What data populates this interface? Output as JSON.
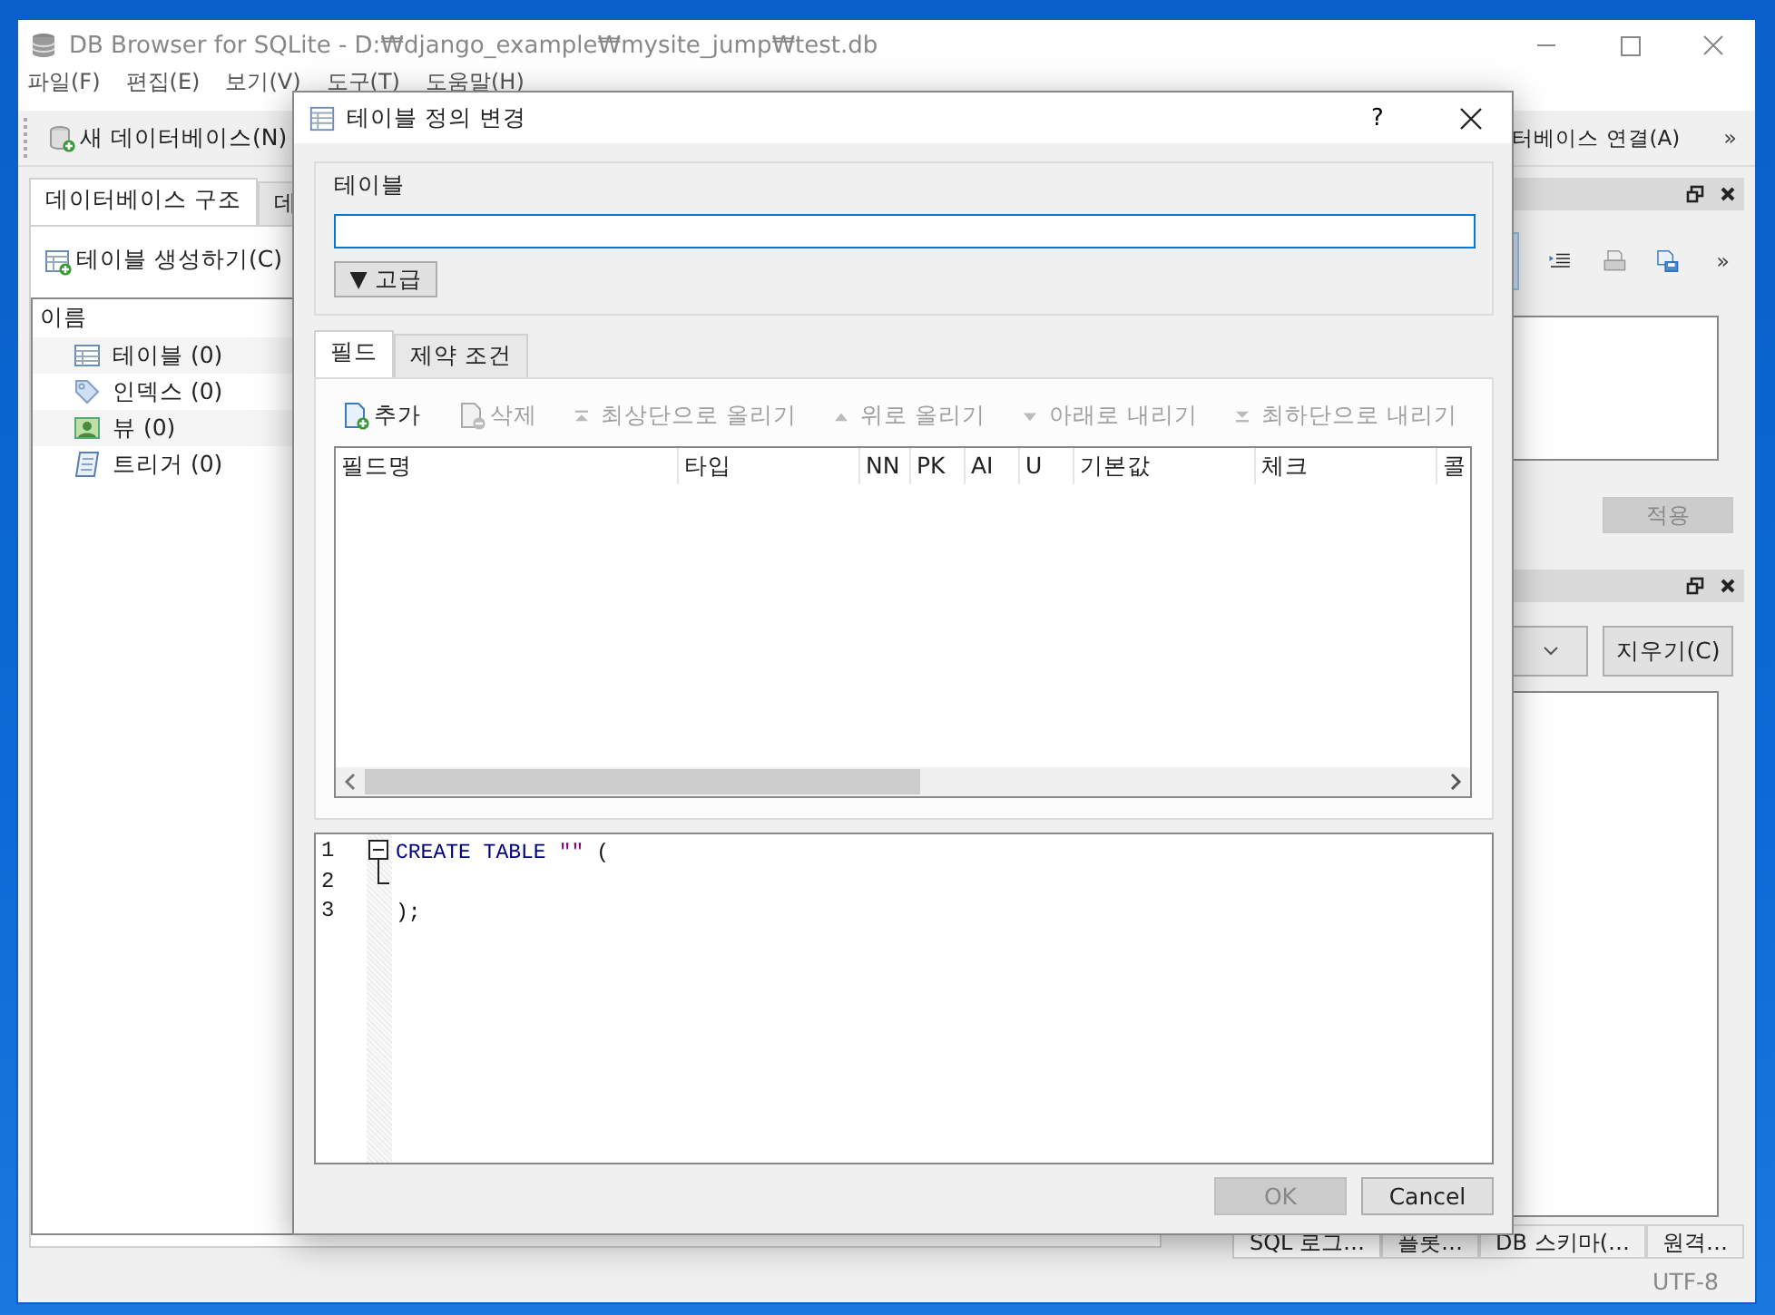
{
  "main_window": {
    "title": "DB Browser for SQLite - D:₩django_example₩mysite_jump₩test.db"
  },
  "menu": [
    "파일(F)",
    "편집(E)",
    "보기(V)",
    "도구(T)",
    "도움말(H)"
  ],
  "toolbar": {
    "new_database": "새 데이터베이스(N)",
    "open_connection": "터베이스 연결(A)",
    "overflow": "»"
  },
  "left_tabs": [
    {
      "label": "데이터베이스 구조",
      "selected": true
    },
    {
      "label": "데",
      "selected": false
    }
  ],
  "create_table_button": "테이블 생성하기(C)",
  "tree": {
    "column": "이름",
    "items": [
      {
        "label": "테이블 (0)",
        "kind": "table"
      },
      {
        "label": "인덱스 (0)",
        "kind": "index"
      },
      {
        "label": "뷰 (0)",
        "kind": "view"
      },
      {
        "label": "트리거 (0)",
        "kind": "trigger"
      }
    ]
  },
  "edit_panel": {
    "overflow": "»",
    "apply_button": {
      "label": "적용",
      "disabled": true
    }
  },
  "log_panel": {
    "clear_button": "지우기(C)"
  },
  "bottom_tabs": [
    {
      "label": "SQL 로그…",
      "selected": true
    },
    {
      "label": "플롯…",
      "selected": false
    },
    {
      "label": "DB 스키마(…",
      "selected": false
    },
    {
      "label": "원격…",
      "selected": false
    }
  ],
  "status_bar": {
    "encoding": "UTF-8"
  },
  "dialog": {
    "title": "테이블 정의 변경",
    "help": "?",
    "table_group": {
      "title": "테이블",
      "advanced_button": "▼ 고급"
    },
    "tabs": [
      {
        "label": "필드",
        "selected": true
      },
      {
        "label": "제약 조건",
        "selected": false
      }
    ],
    "field_toolbar": [
      {
        "label": "추가",
        "kind": "add",
        "disabled": false
      },
      {
        "label": "삭제",
        "kind": "remove",
        "disabled": true
      },
      {
        "label": "최상단으로 올리기",
        "kind": "top",
        "disabled": true
      },
      {
        "label": "위로 올리기",
        "kind": "up",
        "disabled": true
      },
      {
        "label": "아래로 내리기",
        "kind": "down",
        "disabled": true
      },
      {
        "label": "최하단으로 내리기",
        "kind": "bottom",
        "disabled": true
      }
    ],
    "fields_table": {
      "columns": [
        "필드명",
        "타입",
        "NN",
        "PK",
        "AI",
        "U",
        "기본값",
        "체크",
        "콜"
      ]
    },
    "sql_editor": {
      "lines": [
        {
          "number": "1",
          "tokens": [
            {
              "text": "CREATE TABLE",
              "kind": "keyword"
            },
            {
              "text": "\"\"",
              "kind": "string"
            },
            {
              "text": "(",
              "kind": "plain"
            }
          ]
        },
        {
          "number": "2"
        },
        {
          "number": "3",
          "tokens": [
            {
              "text": ");",
              "kind": "plain"
            }
          ]
        }
      ]
    },
    "buttons": [
      {
        "label": "OK",
        "disabled": true
      },
      {
        "label": "Cancel",
        "disabled": false
      }
    ]
  }
}
